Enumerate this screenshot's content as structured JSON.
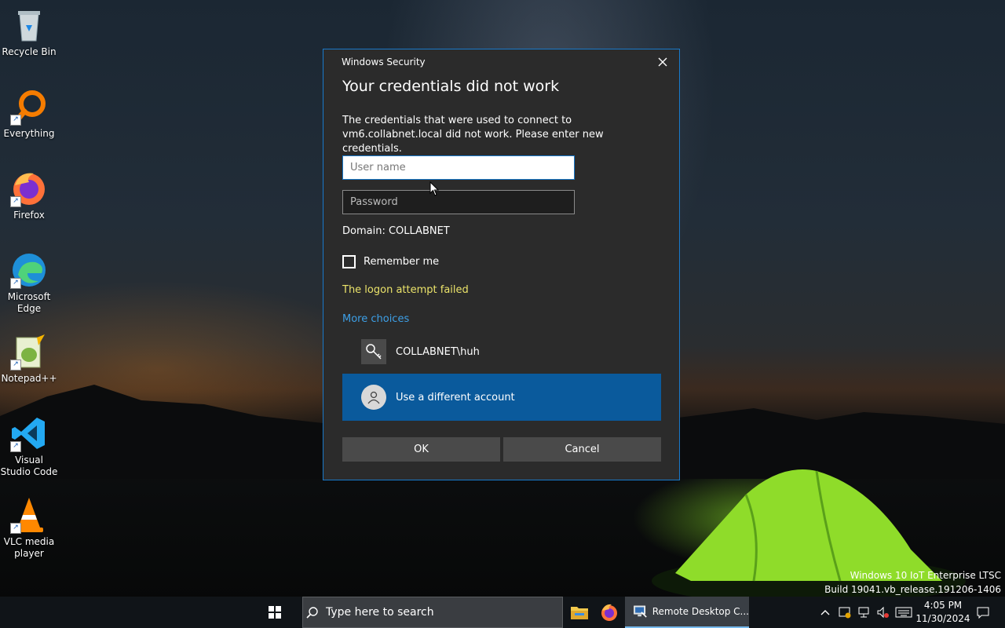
{
  "desktop": {
    "icons": [
      {
        "label": "Recycle Bin"
      },
      {
        "label": "Everything"
      },
      {
        "label": "Firefox"
      },
      {
        "label": "Microsoft Edge"
      },
      {
        "label": "Notepad++"
      },
      {
        "label": "Visual Studio Code"
      },
      {
        "label": "VLC media player"
      }
    ]
  },
  "dialog": {
    "caption": "Windows Security",
    "title": "Your credentials did not work",
    "message": "The credentials that were used to connect to vm6.collabnet.local did not work. Please enter new credentials.",
    "username_placeholder": "User name",
    "password_placeholder": "Password",
    "domain": "Domain: COLLABNET",
    "remember_label": "Remember me",
    "error": "The logon attempt failed",
    "more_choices": "More choices",
    "saved_account": "COLLABNET\\huh",
    "different_account": "Use a different account",
    "ok_label": "OK",
    "cancel_label": "Cancel"
  },
  "watermark": {
    "line1": "Windows 10 IoT Enterprise LTSC",
    "line2": "Build 19041.vb_release.191206-1406"
  },
  "taskbar": {
    "search_placeholder": "Type here to search",
    "rdp_label": "Remote Desktop C...",
    "time": "4:05 PM",
    "date": "11/30/2024"
  },
  "colors": {
    "accent": "#0a5a9c",
    "error": "#ebe36a",
    "link": "#3d9fe6"
  }
}
